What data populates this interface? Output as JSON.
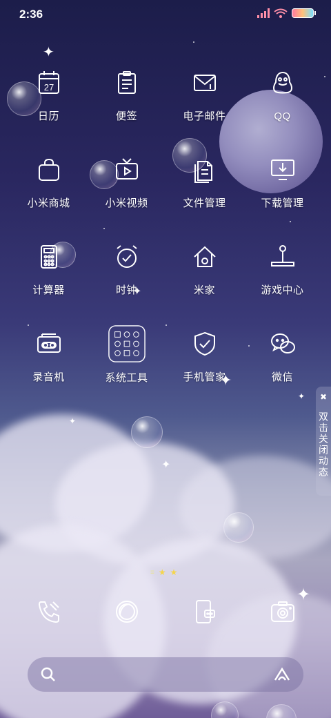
{
  "status_bar": {
    "time": "2:36",
    "icons": [
      "signal-icon",
      "wifi-icon",
      "battery-icon"
    ]
  },
  "apps": [
    {
      "label": "日历",
      "icon": "calendar-icon",
      "badge": "27"
    },
    {
      "label": "便签",
      "icon": "notes-icon"
    },
    {
      "label": "电子邮件",
      "icon": "email-icon"
    },
    {
      "label": "QQ",
      "icon": "qq-penguin-icon"
    },
    {
      "label": "小米商城",
      "icon": "shopping-bag-icon"
    },
    {
      "label": "小米视频",
      "icon": "tv-play-icon"
    },
    {
      "label": "文件管理",
      "icon": "files-icon"
    },
    {
      "label": "下载管理",
      "icon": "download-monitor-icon"
    },
    {
      "label": "计算器",
      "icon": "calculator-icon"
    },
    {
      "label": "时钟",
      "icon": "alarm-clock-icon"
    },
    {
      "label": "米家",
      "icon": "smart-home-icon"
    },
    {
      "label": "游戏中心",
      "icon": "joystick-icon"
    },
    {
      "label": "录音机",
      "icon": "cassette-recorder-icon"
    },
    {
      "label": "系统工具",
      "icon": "tools-folder-icon"
    },
    {
      "label": "手机管家",
      "icon": "shield-check-icon"
    },
    {
      "label": "微信",
      "icon": "wechat-icon"
    }
  ],
  "side_tab": {
    "close": "✖",
    "text": "双击关闭动态"
  },
  "page_indicator": {
    "lines": "≡",
    "stars": [
      "★",
      "★"
    ]
  },
  "dock": [
    {
      "icon": "phone-icon"
    },
    {
      "icon": "browser-circle-icon"
    },
    {
      "icon": "messages-icon"
    },
    {
      "icon": "camera-icon"
    }
  ],
  "search": {
    "placeholder": "",
    "left_icon": "search-icon",
    "right_icon": "assistant-icon"
  },
  "colors": {
    "battery_gradient": [
      "#ff7a9e",
      "#ffc27a",
      "#7ae0ff"
    ],
    "signal": "#ff8fa8",
    "wifi": "#ff8fa8",
    "page_star": "#f5d54a"
  }
}
